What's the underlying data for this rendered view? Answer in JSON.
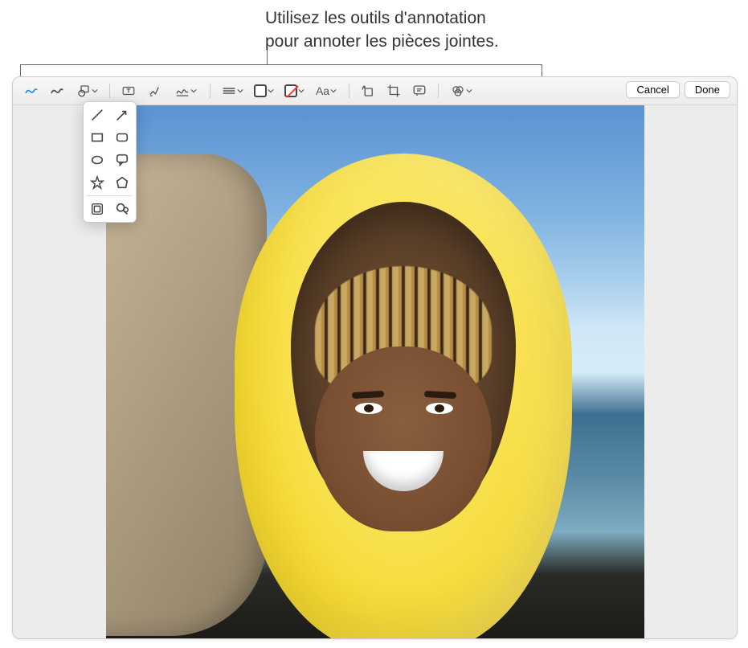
{
  "callout": {
    "line1": "Utilisez les outils d'annotation",
    "line2": "pour annoter les pièces jointes."
  },
  "toolbar": {
    "sketch": "sketch",
    "draw": "draw",
    "shapes": "shapes",
    "text": "text",
    "highlight": "highlight",
    "sign": "sign",
    "shape_style": "shape-style",
    "border_color": "border-color",
    "fill_color": "fill-color",
    "text_style": "Aa",
    "rotate": "rotate",
    "crop": "crop",
    "description": "description",
    "adjust": "adjust"
  },
  "shapes_popup": {
    "line": "line",
    "arrow": "arrow",
    "rect": "rectangle",
    "rounded_rect": "rounded-rectangle",
    "oval": "oval",
    "speech": "speech-bubble",
    "star": "star",
    "polygon": "polygon",
    "loupe": "loupe",
    "mask": "mask"
  },
  "buttons": {
    "cancel": "Cancel",
    "done": "Done"
  }
}
